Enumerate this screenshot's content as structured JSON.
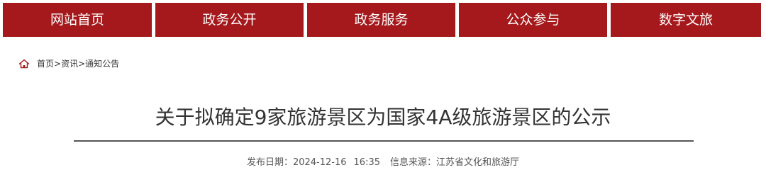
{
  "nav": {
    "items": [
      {
        "label": "网站首页"
      },
      {
        "label": "政务公开"
      },
      {
        "label": "政务服务"
      },
      {
        "label": "公众参与"
      },
      {
        "label": "数字文旅"
      }
    ]
  },
  "breadcrumb": {
    "home_icon": "home-icon",
    "items": [
      "首页",
      "资讯",
      "通知公告"
    ],
    "separator": ">"
  },
  "article": {
    "title": "关于拟确定9家旅游景区为国家4A级旅游景区的公示",
    "date_label": "发布日期：",
    "date": "2024-12-16",
    "time": "16:35",
    "source_label": "信息来源：",
    "source": "江苏省文化和旅游厅"
  },
  "colors": {
    "nav_bg": "#a5181b",
    "nav_text": "#ffffff",
    "home_icon": "#a5181b"
  }
}
